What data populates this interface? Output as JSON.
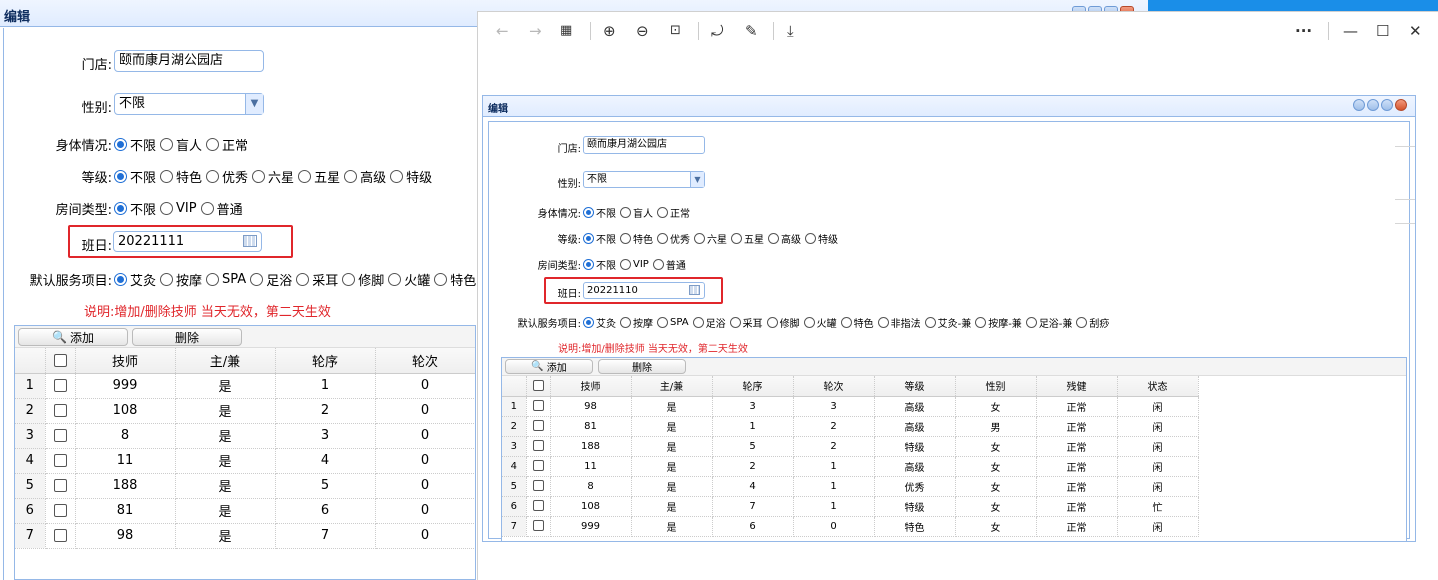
{
  "back_window": {
    "title": "编辑",
    "form": {
      "store_label": "门店:",
      "store_value": "颐而康月湖公园店",
      "gender_label": "性别:",
      "gender_value": "不限",
      "body_label": "身体情况:",
      "body_options": [
        "不限",
        "盲人",
        "正常"
      ],
      "body_selected": 0,
      "grade_label": "等级:",
      "grade_options": [
        "不限",
        "特色",
        "优秀",
        "六星",
        "五星",
        "高级",
        "特级"
      ],
      "grade_selected": 0,
      "room_label": "房间类型:",
      "room_options": [
        "不限",
        "VIP",
        "普通"
      ],
      "room_selected": 0,
      "shift_label": "班日:",
      "shift_value": "20221111",
      "service_label": "默认服务项目:",
      "service_options": [
        "艾灸",
        "按摩",
        "SPA",
        "足浴",
        "采耳",
        "修脚",
        "火罐",
        "特色"
      ],
      "service_selected": 0,
      "note": "说明:增加/删除技师 当天无效，第二天生效"
    },
    "toolbar": {
      "add_label": "添加",
      "delete_label": "删除"
    },
    "columns": [
      "技师",
      "主/兼",
      "轮序",
      "轮次"
    ],
    "rows": [
      {
        "n": "1",
        "tech": "999",
        "main": "是",
        "order": "1",
        "count": "0"
      },
      {
        "n": "2",
        "tech": "108",
        "main": "是",
        "order": "2",
        "count": "0"
      },
      {
        "n": "3",
        "tech": "8",
        "main": "是",
        "order": "3",
        "count": "0"
      },
      {
        "n": "4",
        "tech": "11",
        "main": "是",
        "order": "4",
        "count": "0"
      },
      {
        "n": "5",
        "tech": "188",
        "main": "是",
        "order": "5",
        "count": "0"
      },
      {
        "n": "6",
        "tech": "81",
        "main": "是",
        "order": "6",
        "count": "0"
      },
      {
        "n": "7",
        "tech": "98",
        "main": "是",
        "order": "7",
        "count": "0"
      }
    ]
  },
  "browser": {
    "icons": [
      "back-arrow-icon",
      "forward-arrow-icon",
      "grid-icon",
      "zoom-in-icon",
      "zoom-out-icon",
      "fit-page-icon",
      "rotate-icon",
      "annotate-icon",
      "save-icon",
      "more-icon",
      "minimize-icon",
      "maximize-icon",
      "close-icon"
    ]
  },
  "front_window": {
    "title": "编辑",
    "form": {
      "store_label": "门店:",
      "store_value": "颐而康月湖公园店",
      "gender_label": "性别:",
      "gender_value": "不限",
      "body_label": "身体情况:",
      "body_options": [
        "不限",
        "盲人",
        "正常"
      ],
      "grade_label": "等级:",
      "grade_options": [
        "不限",
        "特色",
        "优秀",
        "六星",
        "五星",
        "高级",
        "特级"
      ],
      "room_label": "房间类型:",
      "room_options": [
        "不限",
        "VIP",
        "普通"
      ],
      "shift_label": "班日:",
      "shift_value": "20221110",
      "service_label": "默认服务项目:",
      "service_options": [
        "艾灸",
        "按摩",
        "SPA",
        "足浴",
        "采耳",
        "修脚",
        "火罐",
        "特色",
        "非指法",
        "艾灸-兼",
        "按摩-兼",
        "足浴-兼",
        "刮痧"
      ],
      "note": "说明:增加/删除技师 当天无效，第二天生效"
    },
    "toolbar": {
      "add_label": "添加",
      "delete_label": "删除"
    },
    "columns": [
      "技师",
      "主/兼",
      "轮序",
      "轮次",
      "等级",
      "性别",
      "残健",
      "状态"
    ],
    "rows": [
      {
        "n": "1",
        "tech": "98",
        "main": "是",
        "order": "3",
        "count": "3",
        "grade": "高级",
        "gender": "女",
        "health": "正常",
        "status": "闲"
      },
      {
        "n": "2",
        "tech": "81",
        "main": "是",
        "order": "1",
        "count": "2",
        "grade": "高级",
        "gender": "男",
        "health": "正常",
        "status": "闲"
      },
      {
        "n": "3",
        "tech": "188",
        "main": "是",
        "order": "5",
        "count": "2",
        "grade": "特级",
        "gender": "女",
        "health": "正常",
        "status": "闲"
      },
      {
        "n": "4",
        "tech": "11",
        "main": "是",
        "order": "2",
        "count": "1",
        "grade": "高级",
        "gender": "女",
        "health": "正常",
        "status": "闲"
      },
      {
        "n": "5",
        "tech": "8",
        "main": "是",
        "order": "4",
        "count": "1",
        "grade": "优秀",
        "gender": "女",
        "health": "正常",
        "status": "闲"
      },
      {
        "n": "6",
        "tech": "108",
        "main": "是",
        "order": "7",
        "count": "1",
        "grade": "特级",
        "gender": "女",
        "health": "正常",
        "status": "忙"
      },
      {
        "n": "7",
        "tech": "999",
        "main": "是",
        "order": "6",
        "count": "0",
        "grade": "特色",
        "gender": "女",
        "health": "正常",
        "status": "闲"
      }
    ]
  },
  "colors": {
    "accent": "#1f6fd6",
    "highlight_box": "#e0262b",
    "border": "#95b8e7"
  }
}
